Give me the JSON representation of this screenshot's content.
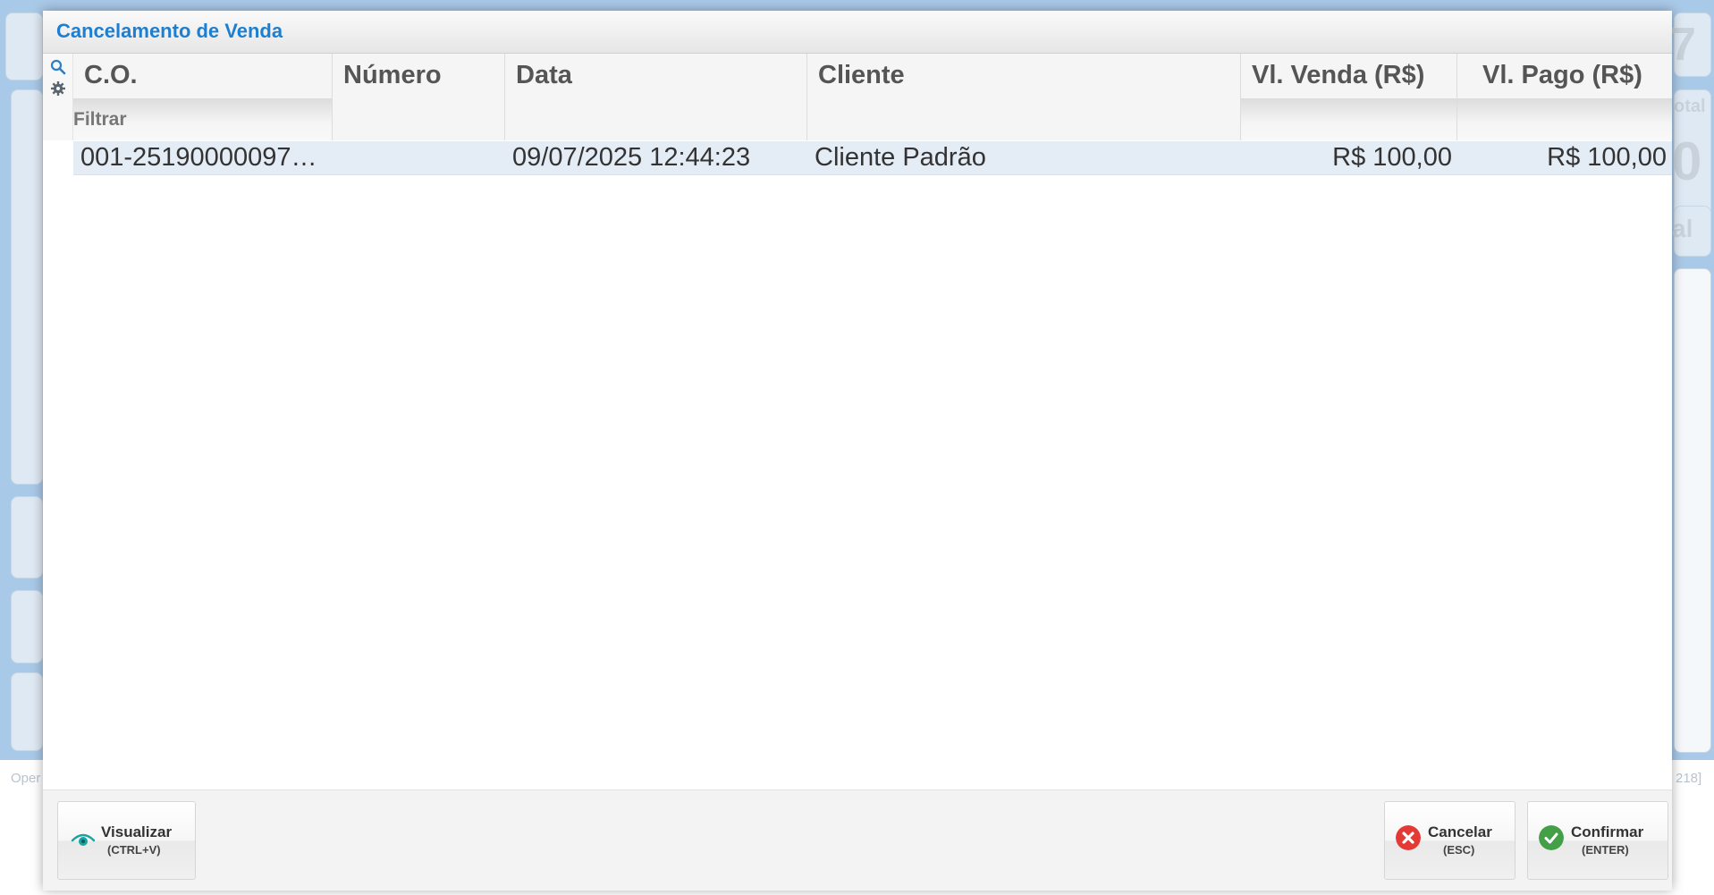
{
  "background": {
    "partial_labels": [
      "otal",
      "0",
      "al",
      "7"
    ],
    "status_left": "Oper",
    "status_right": "218]"
  },
  "modal": {
    "title": "Cancelamento de Venda",
    "columns": [
      {
        "label": "C.O."
      },
      {
        "label": "Número"
      },
      {
        "label": "Data"
      },
      {
        "label": "Cliente"
      },
      {
        "label": "Vl. Venda (R$)"
      },
      {
        "label": "Vl. Pago (R$)"
      }
    ],
    "filter_placeholder": "Filtrar",
    "rows": [
      {
        "co": "001-25190000097…",
        "numero": "",
        "data": "09/07/2025 12:44:23",
        "cliente": "Cliente Padrão",
        "vl_venda": "R$ 100,00",
        "vl_pago": "R$ 100,00"
      }
    ],
    "buttons": {
      "visualizar": {
        "label": "Visualizar",
        "shortcut": "(CTRL+V)"
      },
      "cancelar": {
        "label": "Cancelar",
        "shortcut": "(ESC)"
      },
      "confirmar": {
        "label": "Confirmar",
        "shortcut": "(ENTER)"
      }
    }
  },
  "colors": {
    "title": "#1d7fd1",
    "selected_row": "#e4ecf5",
    "cancel_icon": "#e53935",
    "confirm_icon": "#43a047",
    "eye_icon": "#1aa3a3"
  },
  "icons": [
    "search-icon",
    "gear-icon",
    "eye-icon",
    "close-circle-icon",
    "check-circle-icon"
  ]
}
